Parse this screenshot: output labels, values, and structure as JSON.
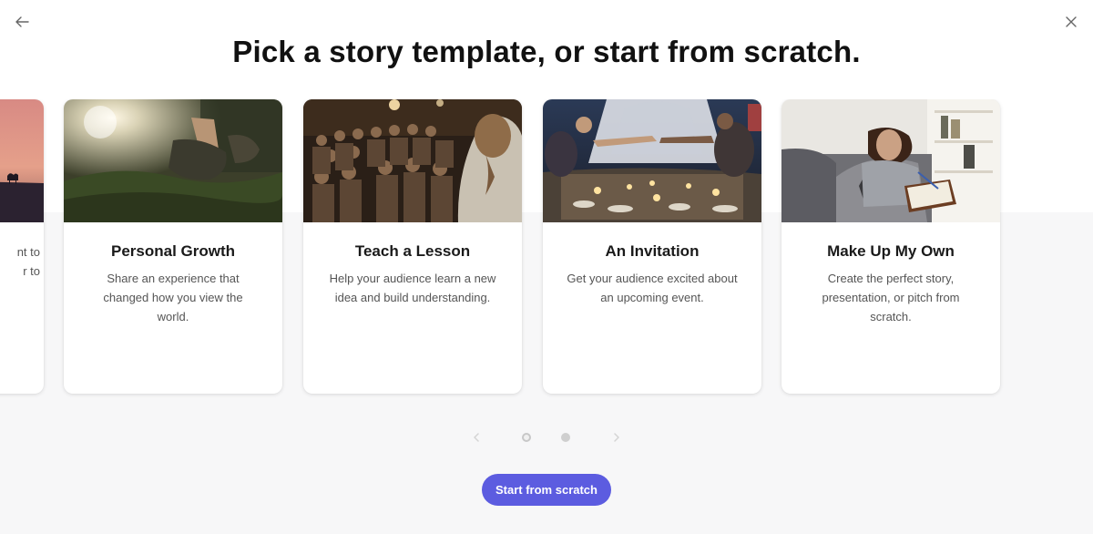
{
  "header": {
    "back_icon": "arrow-left-icon",
    "close_icon": "close-icon",
    "title": "Pick a story template, or start from scratch."
  },
  "cards": [
    {
      "id": "partial",
      "title": "",
      "description_lines": [
        "nt to",
        "r to"
      ],
      "image": "sunset-camel-silhouette"
    },
    {
      "id": "personal-growth",
      "title": "Personal Growth",
      "description_lines": [
        "Share an experience that",
        "changed how you view the",
        "world."
      ],
      "image": "hiking-boots-forest"
    },
    {
      "id": "teach-a-lesson",
      "title": "Teach a Lesson",
      "description_lines": [
        "Help your audience learn a new",
        "idea and build understanding."
      ],
      "image": "lecture-audience"
    },
    {
      "id": "an-invitation",
      "title": "An Invitation",
      "description_lines": [
        "Get your audience excited about",
        "an upcoming event."
      ],
      "image": "outdoor-dinner-party"
    },
    {
      "id": "make-up-my-own",
      "title": "Make Up My Own",
      "description_lines": [
        "Create the perfect story,",
        "presentation, or pitch from",
        "scratch."
      ],
      "image": "woman-writing-journal"
    }
  ],
  "pager": {
    "prev_icon": "chevron-left-icon",
    "next_icon": "chevron-right-icon",
    "pages": 2,
    "current_page": 2
  },
  "cta": {
    "label": "Start from scratch",
    "color": "#5c5ce0"
  },
  "colors": {
    "accent": "#5c5ce0",
    "background_lower": "#f7f7f8"
  }
}
